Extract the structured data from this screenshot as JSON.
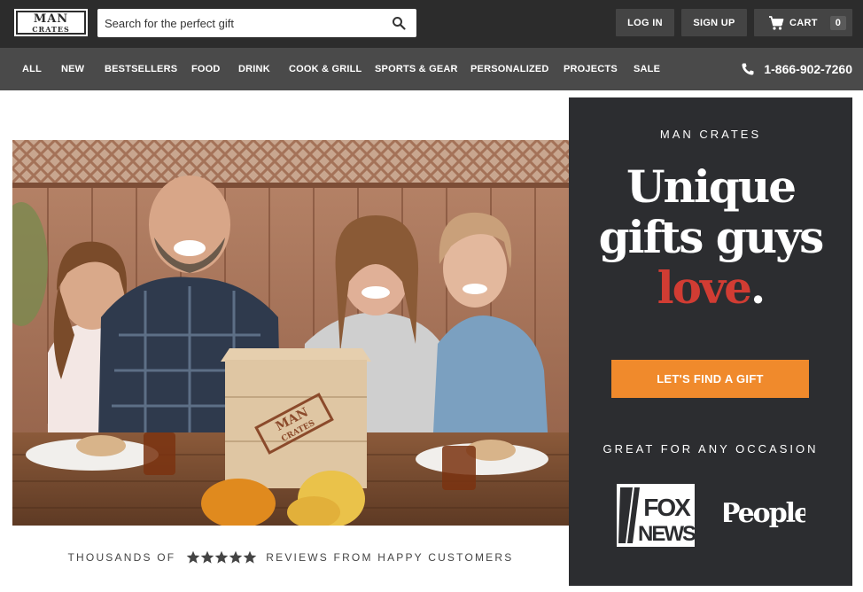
{
  "header": {
    "logo": {
      "line1": "MAN",
      "line2": "CRATES"
    },
    "search": {
      "placeholder": "Search for the perfect gift",
      "value": ""
    },
    "login_label": "LOG IN",
    "signup_label": "SIGN UP",
    "cart_label": "CART",
    "cart_count": "0"
  },
  "nav": {
    "items": [
      {
        "label": "ALL"
      },
      {
        "label": "NEW"
      },
      {
        "label": "BESTSELLERS"
      },
      {
        "label": "FOOD"
      },
      {
        "label": "DRINK"
      },
      {
        "label": "COOK & GRILL"
      },
      {
        "label": "SPORTS & GEAR"
      },
      {
        "label": "PERSONALIZED"
      },
      {
        "label": "PROJECTS"
      },
      {
        "label": "SALE"
      }
    ],
    "phone": "1-866-902-7260"
  },
  "hero": {
    "crate_stamp": {
      "line1": "MAN",
      "line2": "CRATES"
    }
  },
  "reviews": {
    "prefix": "THOUSANDS OF",
    "suffix": "REVIEWS FROM HAPPY CUSTOMERS",
    "stars": 5
  },
  "panel": {
    "brand": "MAN CRATES",
    "headline_line1": "Unique",
    "headline_line2": "gifts guys",
    "headline_accent": "love",
    "headline_end": ".",
    "cta_label": "LET'S FIND A GIFT",
    "occasion_label": "GREAT FOR ANY OCCASION",
    "press": {
      "fox_line1": "FOX",
      "fox_line2": "NEWS",
      "people": "People"
    }
  },
  "colors": {
    "topbar": "#2c2c2c",
    "navbar": "#4a4a4a",
    "panel": "#2c2d30",
    "accent_red": "#d13c33",
    "cta_orange": "#f08a2c"
  }
}
